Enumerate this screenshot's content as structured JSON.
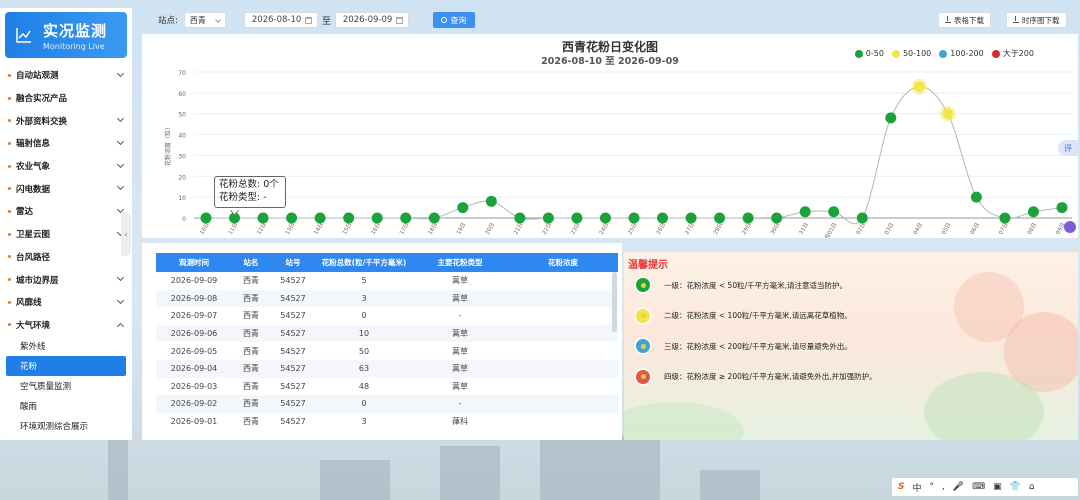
{
  "sidebar": {
    "title": "实况监测",
    "subtitle": "Monitoring Live",
    "items": [
      {
        "label": "自动站观测",
        "chevron": "down"
      },
      {
        "label": "融合实况产品",
        "chevron": ""
      },
      {
        "label": "外部资料交换",
        "chevron": "down"
      },
      {
        "label": "辐射信息",
        "chevron": "down"
      },
      {
        "label": "农业气象",
        "chevron": "down"
      },
      {
        "label": "闪电数据",
        "chevron": "down"
      },
      {
        "label": "雷达",
        "chevron": "down"
      },
      {
        "label": "卫星云图",
        "chevron": "down"
      },
      {
        "label": "台风路径",
        "chevron": ""
      },
      {
        "label": "城市边界层",
        "chevron": "down"
      },
      {
        "label": "风廓线",
        "chevron": "down"
      },
      {
        "label": "大气环境",
        "chevron": "up"
      }
    ],
    "sub_items": [
      {
        "label": "紫外线",
        "active": false
      },
      {
        "label": "花粉",
        "active": true
      },
      {
        "label": "空气质量监测",
        "active": false
      },
      {
        "label": "酸雨",
        "active": false
      },
      {
        "label": "环境观测综合展示",
        "active": false
      }
    ]
  },
  "toolbar": {
    "station_label": "站点:",
    "station_value": "西青",
    "start_date": "2026-08-10",
    "to_label": "至",
    "end_date": "2026-09-09",
    "query_label": "查询",
    "export_table": "表格下载",
    "export_series": "时序图下载"
  },
  "chart_data": {
    "type": "line",
    "title": "西青花粉日变化图",
    "subtitle": "2026-08-10 至 2026-09-09",
    "ylabel": "花粉浓度（粒）",
    "ylim": [
      0,
      70
    ],
    "yticks": [
      0,
      10,
      20,
      30,
      40,
      50,
      60,
      70
    ],
    "x": [
      "10日",
      "11日",
      "12日",
      "13日",
      "14日",
      "15日",
      "16日",
      "17日",
      "18日",
      "19日",
      "20日",
      "21日",
      "22日",
      "23日",
      "24日",
      "25日",
      "26日",
      "27日",
      "28日",
      "29日",
      "30日",
      "31日",
      "09月01日",
      "02日",
      "03日",
      "04日",
      "05日",
      "06日",
      "07日",
      "08日",
      "09日"
    ],
    "values": [
      0,
      0,
      0,
      0,
      0,
      0,
      0,
      0,
      0,
      5,
      8,
      0,
      0,
      0,
      0,
      0,
      0,
      0,
      0,
      0,
      0,
      3,
      3,
      0,
      48,
      63,
      50,
      10,
      0,
      3,
      5
    ],
    "legend": [
      {
        "label": "0-50",
        "color": "#1aa33a"
      },
      {
        "label": "50-100",
        "color": "#f2e64a"
      },
      {
        "label": "100-200",
        "color": "#3aa6d8"
      },
      {
        "label": "大于200",
        "color": "#d42a2a"
      }
    ],
    "tooltip": {
      "line1": "花粉总数: 0个",
      "line2": "花粉类型: -"
    }
  },
  "table": {
    "headers": [
      "观测时间",
      "站名",
      "站号",
      "花粉总数(粒/千平方毫米)",
      "主要花粉类型",
      "花粉浓度"
    ],
    "rows": [
      [
        "2026-09-09",
        "西青",
        "54527",
        "5",
        "蒿草",
        ""
      ],
      [
        "2026-09-08",
        "西青",
        "54527",
        "3",
        "蒿草",
        ""
      ],
      [
        "2026-09-07",
        "西青",
        "54527",
        "0",
        "-",
        ""
      ],
      [
        "2026-09-06",
        "西青",
        "54527",
        "10",
        "蒿草",
        ""
      ],
      [
        "2026-09-05",
        "西青",
        "54527",
        "50",
        "蒿草",
        ""
      ],
      [
        "2026-09-04",
        "西青",
        "54527",
        "63",
        "蒿草",
        ""
      ],
      [
        "2026-09-03",
        "西青",
        "54527",
        "48",
        "蒿草",
        ""
      ],
      [
        "2026-09-02",
        "西青",
        "54527",
        "0",
        "-",
        ""
      ],
      [
        "2026-09-01",
        "西青",
        "54527",
        "3",
        "葎科",
        ""
      ]
    ]
  },
  "tips": {
    "title": "温馨提示",
    "items": [
      {
        "text": "一级：花粉浓度 < 50粒/千平方毫米,请注意适当防护。",
        "color": "#1aa33a"
      },
      {
        "text": "二级：花粉浓度 < 100粒/千平方毫米,请远离花草植物。",
        "color": "#f2e64a"
      },
      {
        "text": "三级：花粉浓度 < 200粒/千平方毫米,请尽量避免外出。",
        "color": "#3aa6d8"
      },
      {
        "text": "四级：花粉浓度 ≥ 200粒/千平方毫米,请避免外出,并加强防护。",
        "color": "#e0574f"
      }
    ]
  },
  "side_tab_label": "评",
  "taskbar": {
    "items": [
      "S",
      "中",
      "°",
      ",",
      "🎤",
      "⌨",
      "▣",
      "👕",
      "⌂"
    ]
  }
}
